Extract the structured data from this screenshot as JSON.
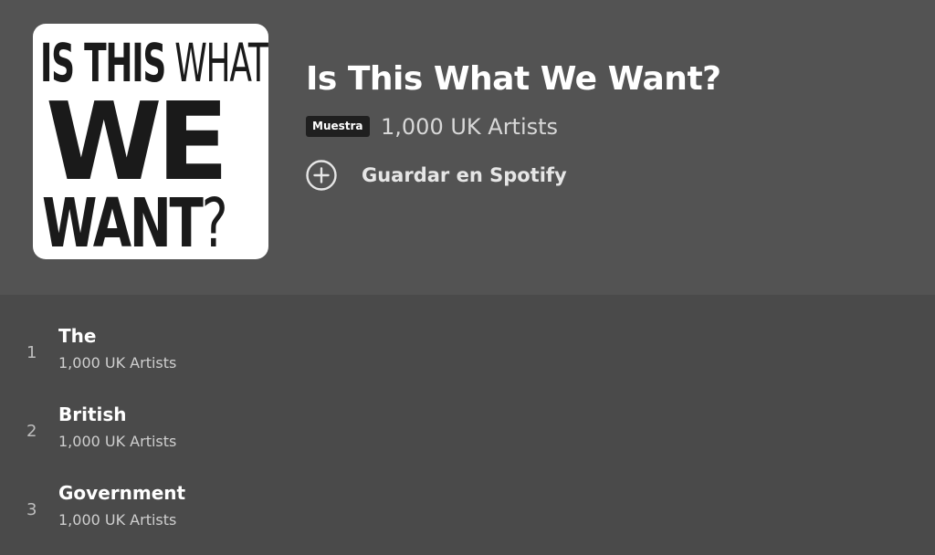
{
  "playlist": {
    "cover_text": {
      "line1_bold": "IS THIS",
      "line1_thin": " WHAT",
      "line2": "WE",
      "line3_bold": "WANT",
      "line3_q": "?"
    },
    "title": "Is This What We Want?",
    "badge": "Muestra",
    "artists": "1,000 UK Artists",
    "save_label": "Guardar en Spotify"
  },
  "tracks": [
    {
      "number": "1",
      "title": "The",
      "artist": "1,000 UK Artists"
    },
    {
      "number": "2",
      "title": "British",
      "artist": "1,000 UK Artists"
    },
    {
      "number": "3",
      "title": "Government",
      "artist": "1,000 UK Artists"
    }
  ],
  "colors": {
    "header_bg": "#535353",
    "list_bg": "#4a4a4a",
    "badge_bg": "#1f1f1f"
  },
  "icons": {
    "save": "plus-circle-icon"
  }
}
